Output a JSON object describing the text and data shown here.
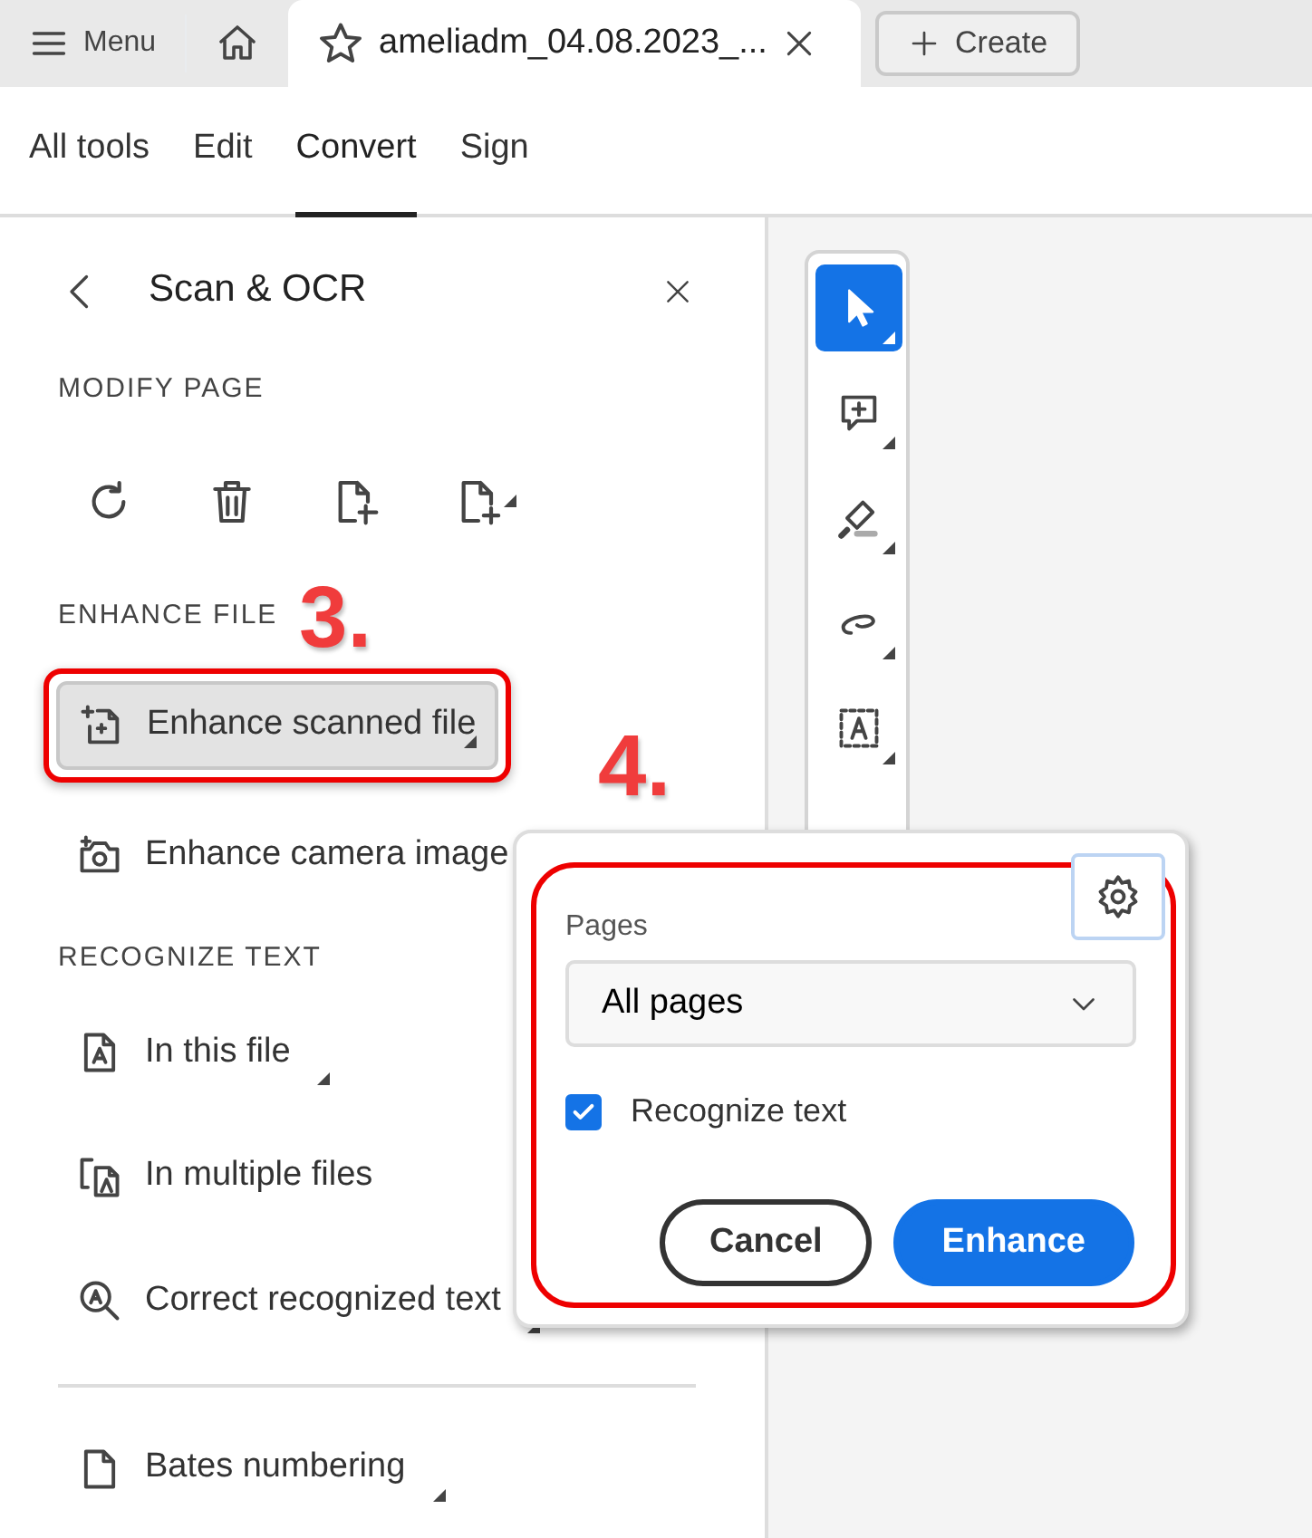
{
  "top_bar": {
    "menu_label": "Menu",
    "document_tab": "ameliadm_04.08.2023_...",
    "create_label": "Create"
  },
  "nav_tabs": [
    {
      "label": "All tools",
      "selected": false
    },
    {
      "label": "Edit",
      "selected": false
    },
    {
      "label": "Convert",
      "selected": true
    },
    {
      "label": "Sign",
      "selected": false
    }
  ],
  "panel": {
    "title": "Scan & OCR",
    "sections": [
      {
        "heading": "MODIFY PAGE",
        "kind": "icons",
        "items": [
          {
            "submenu": false
          },
          {
            "submenu": false
          },
          {
            "submenu": false
          },
          {
            "submenu": true
          }
        ]
      },
      {
        "heading": "ENHANCE FILE",
        "kind": "list",
        "items": [
          {
            "label": "Enhance scanned file",
            "submenu": true,
            "selected": true,
            "highlighted": true
          },
          {
            "label": "Enhance camera image",
            "submenu": false,
            "selected": false,
            "highlighted": false
          }
        ]
      },
      {
        "heading": "RECOGNIZE TEXT",
        "kind": "list",
        "items": [
          {
            "label": "In this file",
            "submenu": true,
            "selected": false,
            "highlighted": false
          },
          {
            "label": "In multiple files",
            "submenu": false,
            "selected": false,
            "highlighted": false
          },
          {
            "label": "Correct recognized text",
            "submenu": true,
            "selected": false,
            "highlighted": false
          }
        ]
      },
      {
        "kind": "list",
        "divider": true,
        "items": [
          {
            "label": "Bates numbering",
            "submenu": true,
            "selected": false,
            "highlighted": false
          }
        ]
      }
    ]
  },
  "tool_rail": [
    {
      "kind": "select",
      "selected": true
    },
    {
      "kind": "comment",
      "selected": false
    },
    {
      "kind": "highlight",
      "selected": false
    },
    {
      "kind": "draw",
      "selected": false
    },
    {
      "kind": "text-select",
      "selected": false
    }
  ],
  "popover": {
    "field_label": "Pages",
    "dropdown_value": "All pages",
    "checkbox": {
      "label": "Recognize text",
      "checked": true
    },
    "buttons": [
      {
        "label": "Cancel",
        "kind": "secondary"
      },
      {
        "label": "Enhance",
        "kind": "primary"
      }
    ]
  },
  "annotations": [
    {
      "label": "3."
    },
    {
      "label": "4."
    }
  ]
}
